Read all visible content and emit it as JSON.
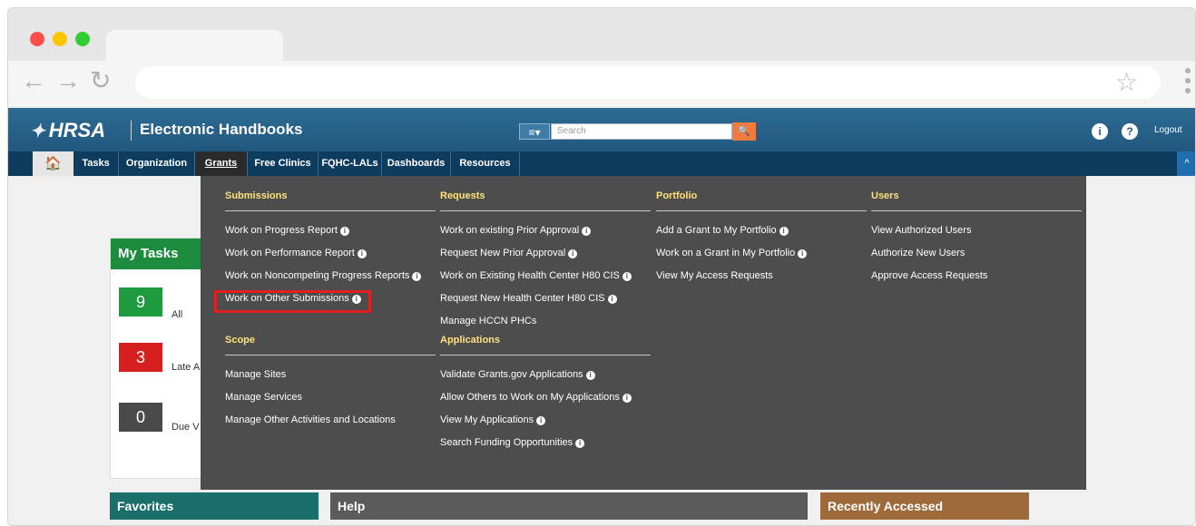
{
  "header": {
    "logo_text": "HRSA",
    "app_title": "Electronic Handbooks",
    "search_placeholder": "Search",
    "menu_toggle": "≡▾",
    "search_button_icon": "🔍",
    "profile_icon": "i",
    "help_icon": "?",
    "logout": "Logout"
  },
  "nav": {
    "home_icon": "🏠",
    "items": [
      "Tasks",
      "Organization",
      "Grants",
      "Free Clinics",
      "FQHC-LALs",
      "Dashboards",
      "Resources"
    ],
    "active": "Grants",
    "collapse_icon": "^"
  },
  "my_tasks": {
    "title": "My Tasks",
    "rows": [
      {
        "count": "9",
        "label": "All",
        "color": "#1e9b3e"
      },
      {
        "count": "3",
        "label": "Late A",
        "color": "#d62020"
      },
      {
        "count": "0",
        "label": "Due V",
        "color": "#4a4a4a"
      }
    ]
  },
  "panels": {
    "favorites": "Favorites",
    "help": "Help",
    "recent": "Recently Accessed"
  },
  "mega_menu": {
    "submissions": {
      "title": "Submissions",
      "items": [
        {
          "label": "Work on Progress Report",
          "info": true
        },
        {
          "label": "Work on Performance Report",
          "info": true
        },
        {
          "label": "Work on Noncompeting Progress Reports",
          "info": true
        },
        {
          "label": "Work on Other Submissions",
          "info": true,
          "highlighted": true
        }
      ]
    },
    "scope": {
      "title": "Scope",
      "items": [
        {
          "label": "Manage Sites",
          "info": false
        },
        {
          "label": "Manage Services",
          "info": false
        },
        {
          "label": "Manage Other Activities and Locations",
          "info": false
        }
      ]
    },
    "requests": {
      "title": "Requests",
      "items": [
        {
          "label": "Work on existing Prior Approval",
          "info": true
        },
        {
          "label": "Request New Prior Approval",
          "info": true
        },
        {
          "label": "Work on Existing Health Center H80 CIS",
          "info": true
        },
        {
          "label": "Request New Health Center H80 CIS",
          "info": true
        },
        {
          "label": "Manage HCCN PHCs",
          "info": false
        }
      ]
    },
    "applications": {
      "title": "Applications",
      "items": [
        {
          "label": "Validate Grants.gov Applications",
          "info": true
        },
        {
          "label": "Allow Others to Work on My Applications",
          "info": true
        },
        {
          "label": "View My Applications",
          "info": true
        },
        {
          "label": "Search Funding Opportunities",
          "info": true
        }
      ]
    },
    "portfolio": {
      "title": "Portfolio",
      "items": [
        {
          "label": "Add a Grant to My Portfolio",
          "info": true
        },
        {
          "label": "Work on a Grant in My Portfolio",
          "info": true
        },
        {
          "label": "View My Access Requests",
          "info": false
        }
      ]
    },
    "users": {
      "title": "Users",
      "items": [
        {
          "label": "View Authorized Users",
          "info": false
        },
        {
          "label": "Authorize New Users",
          "info": false
        },
        {
          "label": "Approve Access Requests",
          "info": false
        }
      ]
    }
  }
}
